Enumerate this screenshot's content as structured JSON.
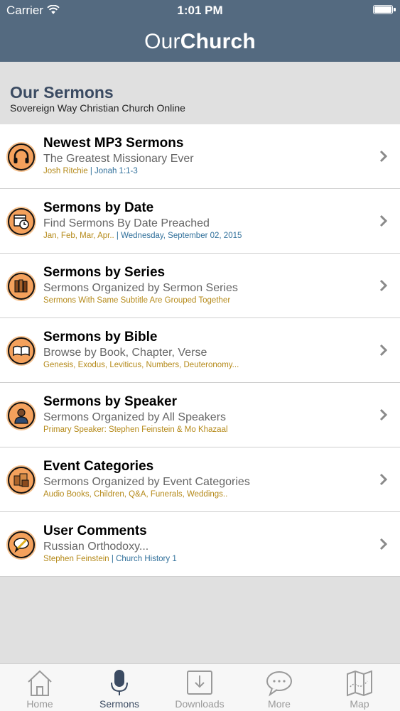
{
  "status_bar": {
    "carrier": "Carrier",
    "time": "1:01 PM",
    "battery_level": 1.0
  },
  "nav": {
    "title_light": "Our",
    "title_bold": "Church"
  },
  "header": {
    "title": "Our Sermons",
    "subtitle": "Sovereign Way Christian Church Online"
  },
  "items": [
    {
      "title": "Newest MP3 Sermons",
      "subtitle": "The Greatest Missionary Ever",
      "detail_a": "Josh Ritchie",
      "separator": " | ",
      "detail_b": "Jonah 1:1-3",
      "icon": "headphones-icon"
    },
    {
      "title": "Sermons by Date",
      "subtitle": "Find Sermons By Date Preached",
      "detail_a": "Jan, Feb, Mar, Apr..",
      "separator": " | ",
      "detail_b": "Wednesday, September 02, 2015",
      "icon": "calendar-clock-icon"
    },
    {
      "title": "Sermons by Series",
      "subtitle": "Sermons Organized by Sermon Series",
      "detail_a": "Sermons With Same Subtitle Are Grouped Together",
      "separator": "",
      "detail_b": "",
      "icon": "books-icon"
    },
    {
      "title": "Sermons by Bible",
      "subtitle": "Browse by Book, Chapter, Verse",
      "detail_a": "Genesis, Exodus, Leviticus, Numbers, Deuteronomy...",
      "separator": "",
      "detail_b": "",
      "icon": "open-bible-icon"
    },
    {
      "title": "Sermons by Speaker",
      "subtitle": "Sermons Organized by All Speakers",
      "detail_a": "Primary Speaker: Stephen Feinstein & Mo Khazaal",
      "separator": "",
      "detail_b": "",
      "icon": "speaker-person-icon"
    },
    {
      "title": "Event Categories",
      "subtitle": "Sermons Organized by Event Categories",
      "detail_a": "Audio Books, Children, Q&A, Funerals, Weddings..",
      "separator": "",
      "detail_b": "",
      "icon": "categories-icon"
    },
    {
      "title": "User Comments",
      "subtitle": "Russian Orthodoxy...",
      "detail_a": "Stephen Feinstein",
      "separator": " | ",
      "detail_b": "Church History 1",
      "icon": "comment-pen-icon"
    }
  ],
  "tabs": [
    {
      "label": "Home",
      "icon": "home-icon",
      "active": false
    },
    {
      "label": "Sermons",
      "icon": "microphone-icon",
      "active": true
    },
    {
      "label": "Downloads",
      "icon": "download-tray-icon",
      "active": false
    },
    {
      "label": "More",
      "icon": "speech-bubble-icon",
      "active": false
    },
    {
      "label": "Map",
      "icon": "map-icon",
      "active": false
    }
  ],
  "colors": {
    "nav_bar": "#546a80",
    "header_title": "#3b4b62",
    "detail_gold": "#b58a1a",
    "detail_blue": "#2f6f9a",
    "icon_orange": "#f4a15c",
    "tab_active": "#3b4b62",
    "tab_inactive": "#9a9a9a"
  }
}
